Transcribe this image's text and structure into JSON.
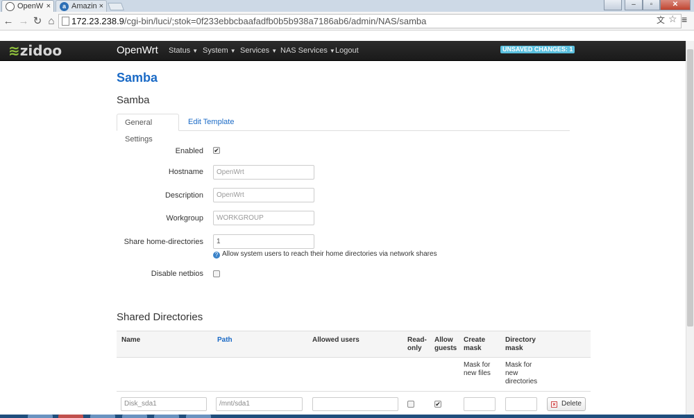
{
  "browser": {
    "tabs": [
      {
        "title": "OpenW",
        "favicon": "openwrt-favicon-icon"
      },
      {
        "title": "Amazin",
        "favicon": "amazon-favicon-icon"
      }
    ],
    "url_host": "172.23.238.9",
    "url_path": "/cgi-bin/luci/;stok=0f233ebbcbaafadfb0b5b938a7186ab6/admin/NAS/samba",
    "icons": {
      "back": "←",
      "forward": "→",
      "reload": "↻",
      "home": "⌂",
      "star": "☆",
      "menu": "≡",
      "translate": "文"
    }
  },
  "header": {
    "logo": "zidoo",
    "brand": "OpenWrt",
    "menu": [
      "Status",
      "System",
      "Services",
      "NAS Services",
      "Logout"
    ],
    "unsaved": "UNSAVED CHANGES: 1",
    "colors": {
      "bar": "#222222",
      "badge": "#5bc0de"
    }
  },
  "page": {
    "title": "Samba",
    "section_title": "Samba",
    "tabs": [
      "General Settings",
      "Edit Template"
    ],
    "fields": {
      "enabled_label": "Enabled",
      "enabled_checked": true,
      "hostname_label": "Hostname",
      "hostname_value": "OpenWrt",
      "description_label": "Description",
      "description_value": "OpenWrt",
      "workgroup_label": "Workgroup",
      "workgroup_value": "WORKGROUP",
      "homedirs_label": "Share home-directories",
      "homedirs_value": "1",
      "homedirs_help": "Allow system users to reach their home directories via network shares",
      "netbios_label": "Disable netbios",
      "netbios_checked": false
    },
    "shares": {
      "title": "Shared Directories",
      "headers": {
        "name": "Name",
        "path": "Path",
        "allowed_users": "Allowed users",
        "read_only": "Read-only",
        "allow_guests": "Allow guests",
        "create_mask": "Create mask",
        "directory_mask": "Directory mask"
      },
      "descriptions": {
        "create_mask": "Mask for new files",
        "directory_mask": "Mask for new directories"
      },
      "rows": [
        {
          "name": "Disk_sda1",
          "path": "/mnt/sda1",
          "allowed_users": "",
          "read_only": false,
          "allow_guests": true,
          "create_mask": "",
          "directory_mask": "",
          "delete_label": "Delete"
        }
      ]
    },
    "colors": {
      "link": "#1a6ac6",
      "title": "#1a6ac6"
    }
  }
}
